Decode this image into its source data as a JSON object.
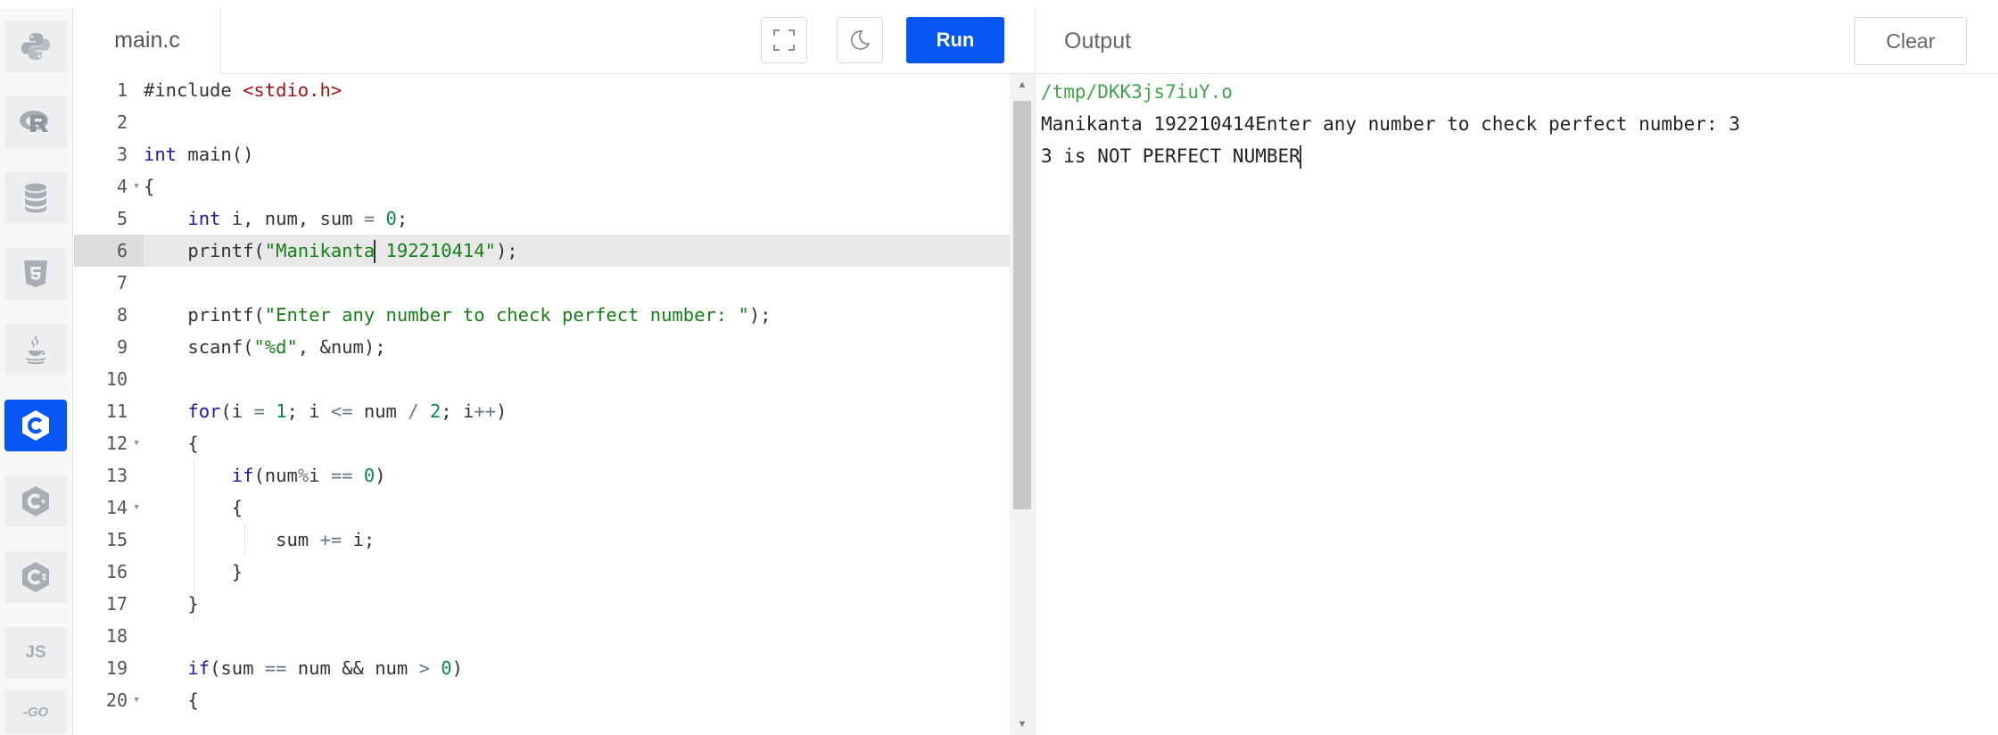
{
  "sidebar": {
    "languages": [
      {
        "id": "python",
        "icon": "python-icon"
      },
      {
        "id": "r",
        "icon": "r-icon"
      },
      {
        "id": "sql",
        "icon": "database-icon"
      },
      {
        "id": "html",
        "icon": "html5-icon"
      },
      {
        "id": "java",
        "icon": "java-icon"
      },
      {
        "id": "c",
        "icon": "c-icon",
        "active": true
      },
      {
        "id": "cpp",
        "icon": "cpp-icon"
      },
      {
        "id": "csharp",
        "icon": "csharp-icon"
      },
      {
        "id": "js",
        "icon": "js-icon",
        "label": "JS"
      },
      {
        "id": "go",
        "icon": "go-icon",
        "label": "-GO"
      }
    ]
  },
  "editor": {
    "file_tab": "main.c",
    "fullscreen_icon": "fullscreen-icon",
    "theme_icon": "moon-icon",
    "run_label": "Run",
    "line_numbers": [
      "1",
      "2",
      "3",
      "4",
      "5",
      "6",
      "7",
      "8",
      "9",
      "10",
      "11",
      "12",
      "13",
      "14",
      "15",
      "16",
      "17",
      "18",
      "19",
      "20"
    ],
    "folded_lines": [
      "4",
      "12",
      "14",
      "20"
    ],
    "code": [
      "#include <stdio.h>",
      "",
      "int main()",
      "{",
      "    int i, num, sum = 0;",
      "    printf(\"Manikanta 192210414\");",
      "",
      "    printf(\"Enter any number to check perfect number: \");",
      "    scanf(\"%d\", &num);",
      "",
      "    for(i = 1; i <= num / 2; i++)",
      "    {",
      "        if(num%i == 0)",
      "        {",
      "            sum += i;",
      "        }",
      "    }",
      "",
      "    if(sum == num && num > 0)",
      "    {"
    ]
  },
  "output": {
    "title": "Output",
    "clear_label": "Clear",
    "lines": [
      "/tmp/DKK3js7iuY.o",
      "Manikanta 192210414Enter any number to check perfect number: 3",
      "3 is NOT PERFECT NUMBER"
    ]
  },
  "colors": {
    "accent": "#0556f3",
    "keyword": "#1a1aa6",
    "string": "#168016",
    "include": "#a31515",
    "number": "#098658",
    "output_path": "#45a34a"
  }
}
